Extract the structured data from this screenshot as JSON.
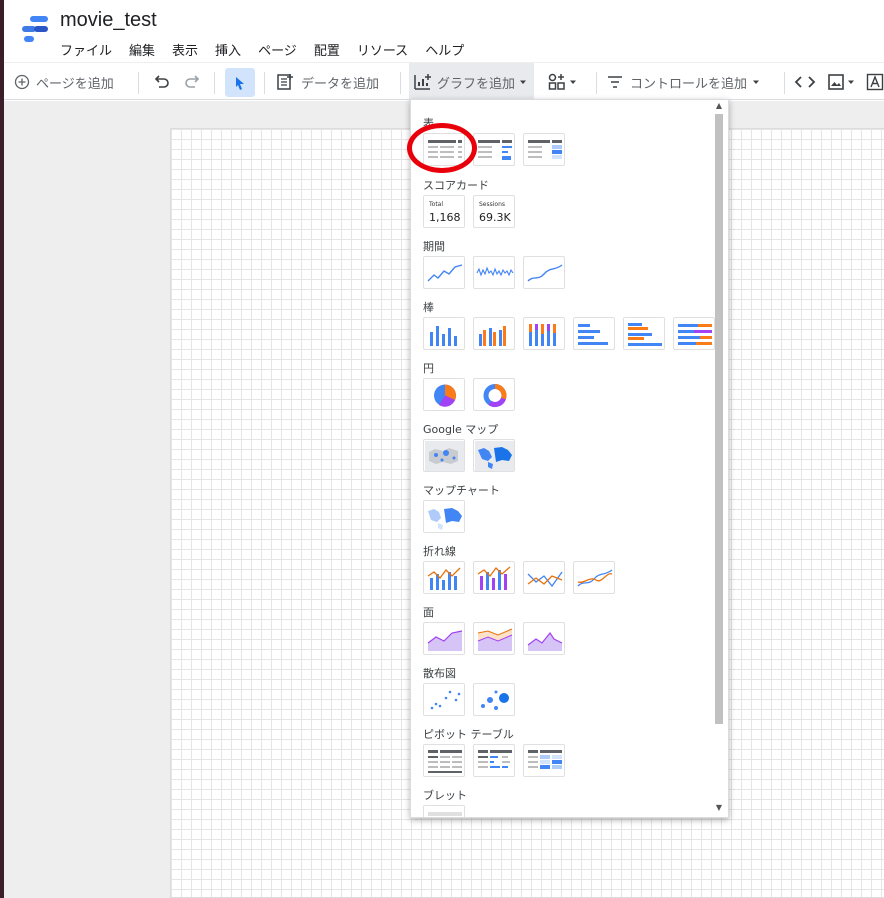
{
  "app": {
    "title": "movie_test",
    "menus": [
      "ファイル",
      "編集",
      "表示",
      "挿入",
      "ページ",
      "配置",
      "リソース",
      "ヘルプ"
    ],
    "brand_color": "#4285f4"
  },
  "toolbar": {
    "add_page": "ページを追加",
    "add_data": "データを追加",
    "add_chart": "グラフを追加",
    "add_control": "コントロールを追加"
  },
  "chart_menu": {
    "categories": {
      "table": "表",
      "scorecard": "スコアカード",
      "timeseries": "期間",
      "bar": "棒",
      "pie": "円",
      "google_maps": "Google マップ",
      "map_chart": "マップチャート",
      "combo": "折れ線",
      "area": "面",
      "scatter": "散布図",
      "pivot": "ピボット テーブル",
      "bullet": "ブレット"
    },
    "scorecards": [
      {
        "label": "Total",
        "value": "1,168"
      },
      {
        "label": "Sessions",
        "value": "69.3K"
      }
    ]
  },
  "annotation": {
    "highlight_color": "#e8000b"
  }
}
